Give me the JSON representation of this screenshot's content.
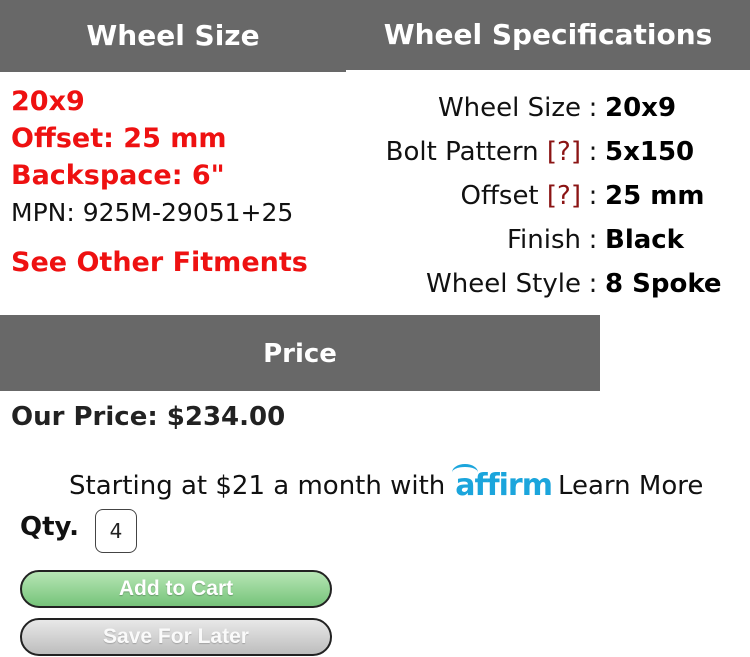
{
  "headers": {
    "wheel_size": "Wheel Size",
    "wheel_specs": "Wheel Specifications",
    "price": "Price"
  },
  "summary": {
    "size": "20x9",
    "offset": "Offset: 25 mm",
    "backspace": "Backspace: 6\"",
    "mpn": "MPN: 925M-29051+25",
    "see_other": "See Other Fitments"
  },
  "specs": [
    {
      "label": "Wheel Size",
      "help": "",
      "value": "20x9"
    },
    {
      "label": "Bolt Pattern",
      "help": "[?]",
      "value": "5x150"
    },
    {
      "label": "Offset",
      "help": "[?]",
      "value": "25 mm"
    },
    {
      "label": "Finish",
      "help": "",
      "value": "Black"
    },
    {
      "label": "Wheel Style",
      "help": "",
      "value": "8 Spoke"
    }
  ],
  "spec_separator": ":",
  "price": {
    "our_price": "Our Price: $234.00",
    "financing_text": "Starting at $21 a month with",
    "affirm": "affirm",
    "learn_more": "Learn More"
  },
  "qty": {
    "label": "Qty.",
    "value": "4"
  },
  "buttons": {
    "add_to_cart": "Add to Cart",
    "save_for_later": "Save For Later"
  },
  "colors": {
    "header_bg": "#686868",
    "highlight_red": "#ee1111",
    "help_link": "#8b1414",
    "affirm_blue": "#1ba5dc",
    "cart_green": "#76c37a"
  }
}
